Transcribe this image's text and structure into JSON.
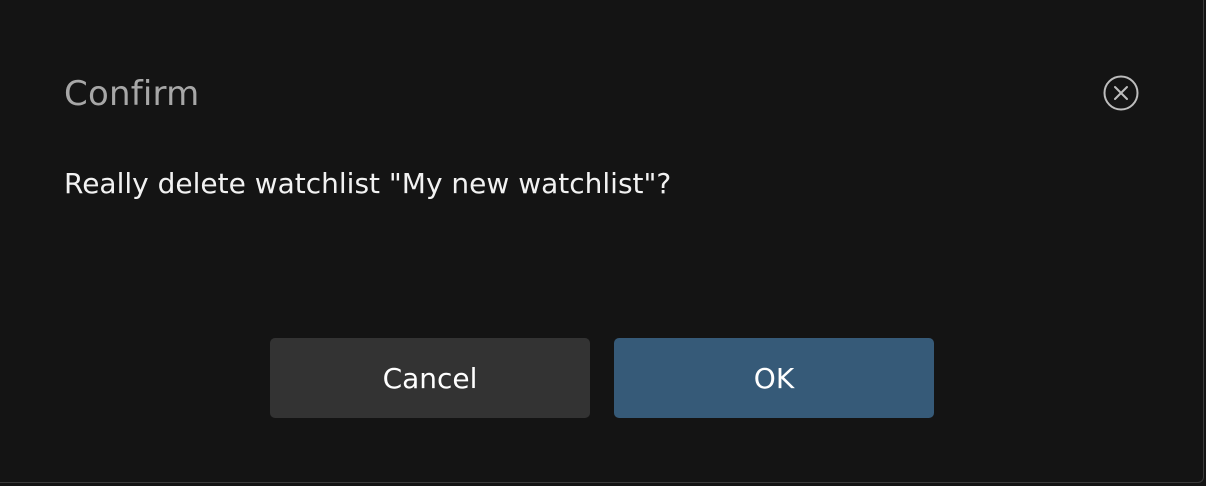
{
  "dialog": {
    "title": "Confirm",
    "message": "Really delete watchlist \"My new watchlist\"?",
    "close_icon": "close-circle-icon",
    "buttons": {
      "cancel_label": "Cancel",
      "ok_label": "OK"
    }
  },
  "colors": {
    "background": "#141414",
    "title": "#a7a7a7",
    "message": "#f2f2f2",
    "cancel_button": "#333333",
    "ok_button": "#365a78"
  }
}
